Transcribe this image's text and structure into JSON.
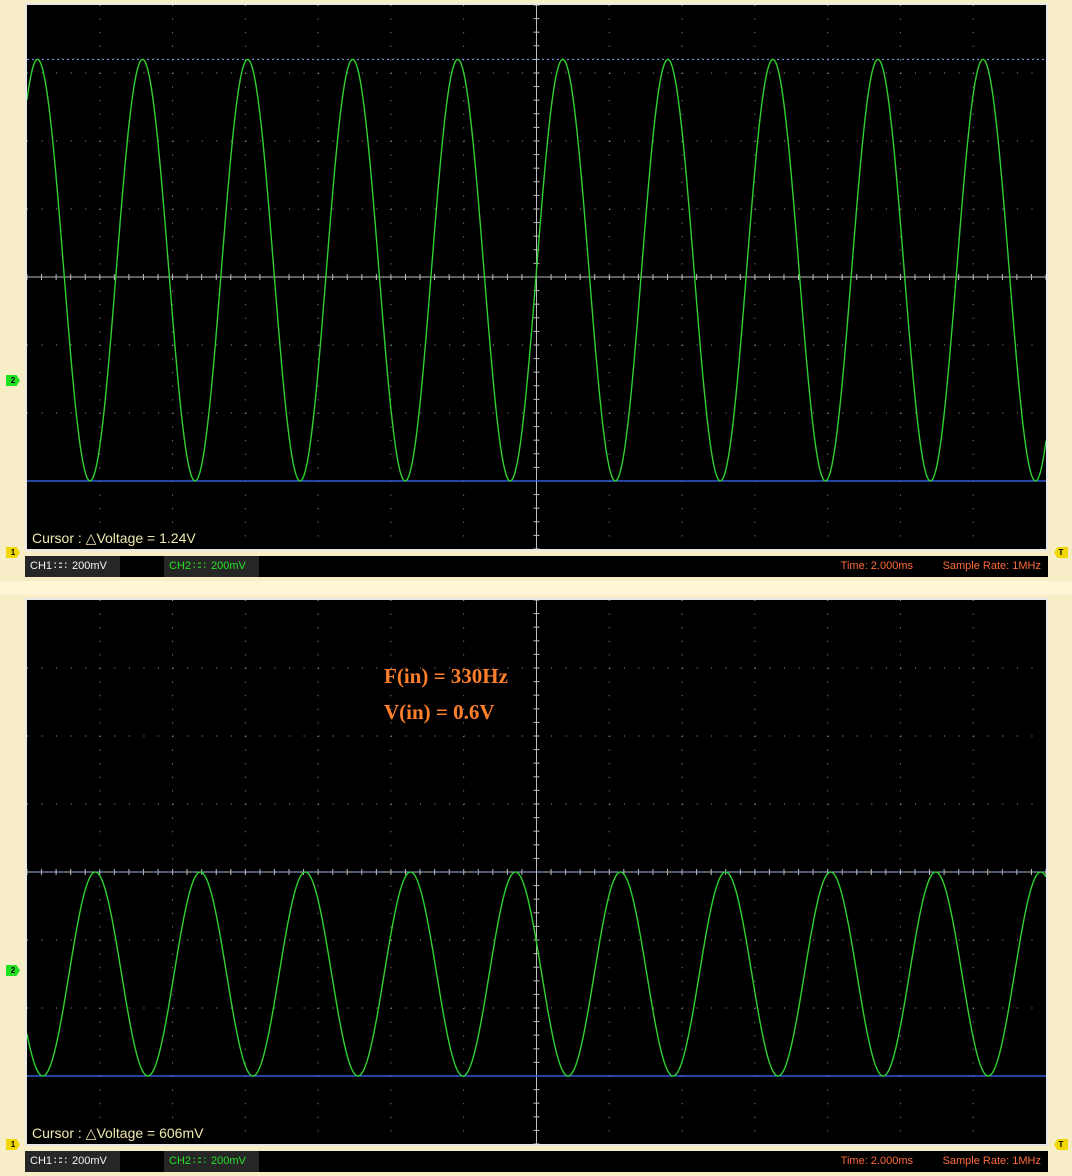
{
  "colors": {
    "trace": "#2fd12f",
    "grid": "#9a9a9a",
    "cursor_line": "#3a6cff",
    "cursor_dotted": "#7aa7ff",
    "readout_text": "#f0e8b0",
    "annotation": "#ff7f2a",
    "status_red": "#ff6a3a"
  },
  "scopes": [
    {
      "cursor_readout": "Cursor : △Voltage = 1.24V",
      "ch2_marker": "2",
      "ch1_marker": "1",
      "trigger_marker": "T",
      "status": {
        "ch1_label": "CH1",
        "ch1_coupling": "∷∷",
        "ch1_scale": "200mV",
        "ch2_label": "CH2",
        "ch2_coupling": "∷∷",
        "ch2_scale": "200mV",
        "time": "Time: 2.000ms",
        "sample_rate": "Sample Rate: 1MHz"
      },
      "chart_data": {
        "type": "line",
        "series": [
          {
            "values_description": "",
            "cycles_visible": 9.7,
            "peak_div": 3.2,
            "trough_div": -3.0,
            "center_div": 0.0,
            "phase_start": 0.9
          }
        ],
        "cursor_levels_div": [
          3.2,
          -3.0
        ],
        "x_divisions": 14,
        "y_divisions": 8
      }
    },
    {
      "cursor_readout": "Cursor : △Voltage = 606mV",
      "annotation_line1": "F(in) = 330Hz",
      "annotation_line2": "V(in) = 0.6V",
      "ch2_marker": "2",
      "ch1_marker": "1",
      "trigger_marker": "T",
      "status": {
        "ch1_label": "CH1",
        "ch1_coupling": "∷∷",
        "ch1_scale": "200mV",
        "ch2_label": "CH2",
        "ch2_coupling": "∷∷",
        "ch2_scale": "200mV",
        "time": "Time: 2.000ms",
        "sample_rate": "Sample Rate: 1MHz"
      },
      "chart_data": {
        "type": "line",
        "series": [
          {
            "values_description": "",
            "cycles_visible": 9.7,
            "peak_div": 0.0,
            "trough_div": -3.0,
            "center_div": -1.5,
            "phase_start": 0.35
          }
        ],
        "cursor_levels_div": [
          0.0,
          -3.0
        ],
        "x_divisions": 14,
        "y_divisions": 8
      }
    }
  ]
}
